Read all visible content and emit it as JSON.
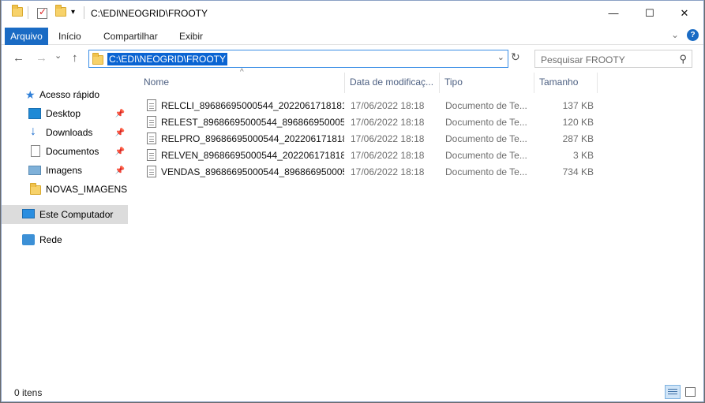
{
  "window": {
    "title": "C:\\EDI\\NEOGRID\\FROOTY",
    "controls": {
      "minimize": "—",
      "maximize": "☐",
      "close": "✕"
    }
  },
  "ribbon": {
    "tabs": [
      "Arquivo",
      "Início",
      "Compartilhar",
      "Exibir"
    ],
    "expand_glyph": "⌄",
    "help_glyph": "?"
  },
  "navbar": {
    "back": "←",
    "forward": "→",
    "recent": "⌄",
    "up": "↑",
    "address": "C:\\EDI\\NEOGRID\\FROOTY",
    "address_dropdown": "⌄",
    "refresh": "↻",
    "search_placeholder": "Pesquisar FROOTY",
    "search_glyph": "⚲"
  },
  "sidebar": {
    "quick_access": "Acesso rápido",
    "pinned": [
      "Desktop",
      "Downloads",
      "Documentos",
      "Imagens"
    ],
    "recent_folder": "NOVAS_IMAGENS",
    "this_pc": "Este Computador",
    "network": "Rede",
    "pin_glyph": "📌"
  },
  "columns": {
    "name": "Nome",
    "date": "Data de modificaç...",
    "type": "Tipo",
    "size": "Tamanho",
    "sort_glyph": "^"
  },
  "files": [
    {
      "name": "RELCLI_89686695000544_20220617181811....",
      "date": "17/06/2022 18:18",
      "type": "Documento de Te...",
      "size": "137 KB"
    },
    {
      "name": "RELEST_89686695000544_89686695000544...",
      "date": "17/06/2022 18:18",
      "type": "Documento de Te...",
      "size": "120 KB"
    },
    {
      "name": "RELPRO_89686695000544_2022061718181...",
      "date": "17/06/2022 18:18",
      "type": "Documento de Te...",
      "size": "287 KB"
    },
    {
      "name": "RELVEN_89686695000544_2022061718181...",
      "date": "17/06/2022 18:18",
      "type": "Documento de Te...",
      "size": "3 KB"
    },
    {
      "name": "VENDAS_89686695000544_8968669500054...",
      "date": "17/06/2022 18:18",
      "type": "Documento de Te...",
      "size": "734 KB"
    }
  ],
  "status": {
    "count": "0 itens"
  },
  "colors": {
    "accent": "#1a6bc4",
    "selection": "#0a64d2",
    "sidebar_selected": "#dcdcdc"
  }
}
